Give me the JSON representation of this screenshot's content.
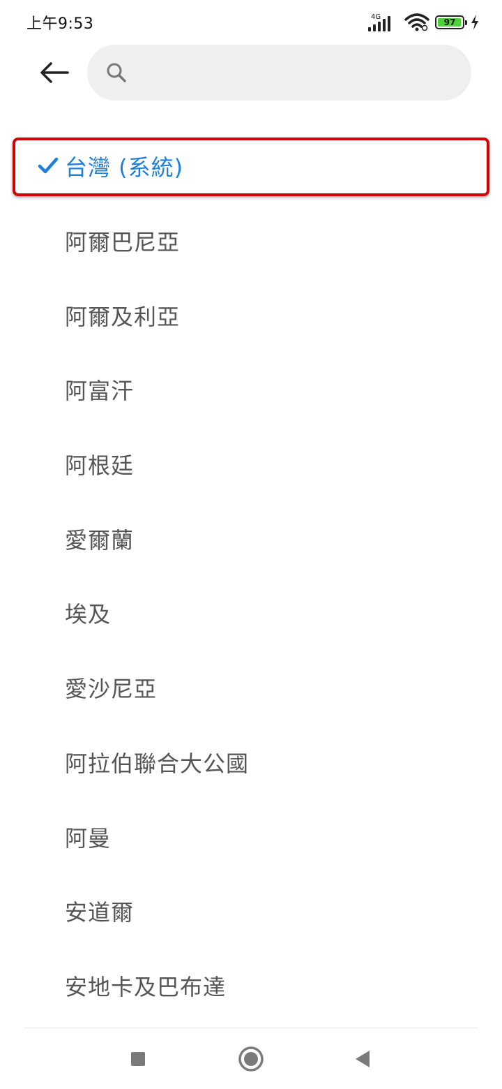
{
  "status_bar": {
    "time": "上午9:53",
    "network_type": "4G",
    "battery_level": "97",
    "battery_fraction": 0.97,
    "battery_color": "#4cd137",
    "icons": [
      "signal-icon",
      "wifi-icon",
      "battery-icon",
      "charging-icon"
    ]
  },
  "header": {
    "back_icon": "arrow-left-icon",
    "search": {
      "value": "",
      "placeholder": "",
      "icon": "search-icon"
    }
  },
  "list": {
    "items": [
      {
        "label": "台灣 (系統)",
        "selected": true
      },
      {
        "label": "阿爾巴尼亞"
      },
      {
        "label": "阿爾及利亞"
      },
      {
        "label": "阿富汗"
      },
      {
        "label": "阿根廷"
      },
      {
        "label": "愛爾蘭"
      },
      {
        "label": "埃及"
      },
      {
        "label": "愛沙尼亞"
      },
      {
        "label": "阿拉伯聯合大公國"
      },
      {
        "label": "阿曼"
      },
      {
        "label": "安道爾"
      },
      {
        "label": "安地卡及巴布達"
      }
    ]
  },
  "colors": {
    "selected_text": "#1e7fdb",
    "item_text": "#555555",
    "highlight_border": "#d40000",
    "search_bg": "#efefef"
  },
  "nav_bar": {
    "icons": [
      "recents-square-icon",
      "home-circle-icon",
      "back-triangle-icon"
    ]
  }
}
